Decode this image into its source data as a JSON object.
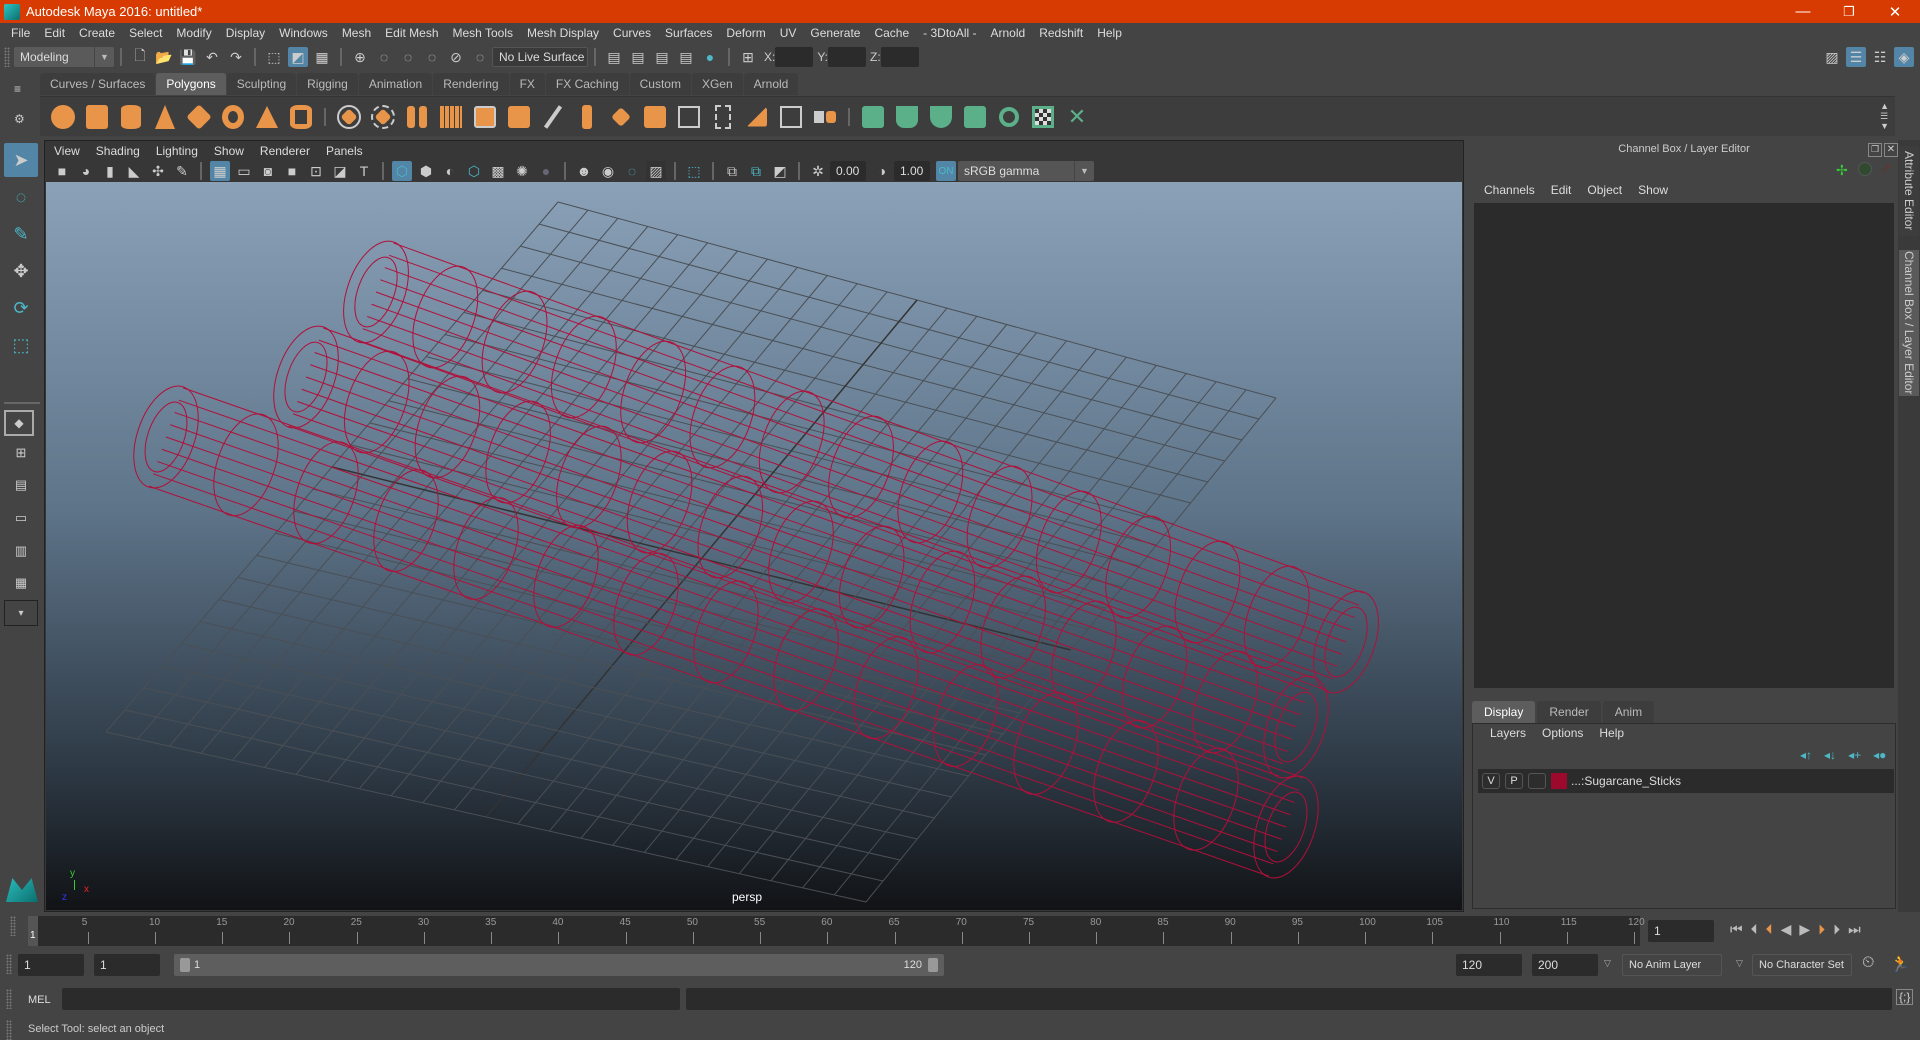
{
  "window": {
    "title": "Autodesk Maya 2016: untitled*",
    "controls": {
      "minimize": "—",
      "restore": "❐",
      "close": "✕"
    }
  },
  "menubar": [
    "File",
    "Edit",
    "Create",
    "Select",
    "Modify",
    "Display",
    "Windows",
    "Mesh",
    "Edit Mesh",
    "Mesh Tools",
    "Mesh Display",
    "Curves",
    "Surfaces",
    "Deform",
    "UV",
    "Generate",
    "Cache",
    "- 3DtoAll -",
    "Arnold",
    "Redshift",
    "Help"
  ],
  "statusline": {
    "menuset": "Modeling",
    "live_surface": "No Live Surface",
    "x_label": "X:",
    "y_label": "Y:",
    "z_label": "Z:",
    "x_value": "",
    "y_value": "",
    "z_value": ""
  },
  "shelf": {
    "tabs": [
      "Curves / Surfaces",
      "Polygons",
      "Sculpting",
      "Rigging",
      "Animation",
      "Rendering",
      "FX",
      "FX Caching",
      "Custom",
      "XGen",
      "Arnold"
    ],
    "active_tab": "Polygons",
    "icons": [
      "poly-sphere",
      "poly-cube",
      "poly-cylinder",
      "poly-cone",
      "poly-plane",
      "poly-torus",
      "poly-pyramid",
      "poly-pipe",
      "combine",
      "separate",
      "mirror",
      "smooth",
      "extract",
      "boolean",
      "bevel",
      "bridge",
      "extrude",
      "append",
      "multi-cut",
      "target-weld",
      "connect",
      "offset-edge-loop",
      "uv-planar",
      "uv-cylindrical",
      "uv-spherical",
      "uv-automatic",
      "uv-contour",
      "uv-editor",
      "uv-unfold"
    ]
  },
  "viewport": {
    "menu": [
      "View",
      "Shading",
      "Lighting",
      "Show",
      "Renderer",
      "Panels"
    ],
    "exposure": "0.00",
    "gamma": "1.00",
    "color_space": "sRGB gamma",
    "camera_label": "persp",
    "axis": {
      "x": "x",
      "y": "y",
      "z": "z"
    },
    "wire_color": "#b0103a"
  },
  "channel_box": {
    "title": "Channel Box / Layer Editor",
    "menu": [
      "Channels",
      "Edit",
      "Object",
      "Show"
    ]
  },
  "layer_editor": {
    "tabs": [
      "Display",
      "Render",
      "Anim"
    ],
    "active_tab": "Display",
    "menu": [
      "Layers",
      "Options",
      "Help"
    ],
    "layers": [
      {
        "v": "V",
        "p": "P",
        "color": "#9b0a2d",
        "name": "...:Sugarcane_Sticks"
      }
    ]
  },
  "side_tabs": [
    "Attribute Editor",
    "Channel Box / Layer Editor"
  ],
  "timeline": {
    "ticks": [
      5,
      10,
      15,
      20,
      25,
      30,
      35,
      40,
      45,
      50,
      55,
      60,
      65,
      70,
      75,
      80,
      85,
      90,
      95,
      100,
      105,
      110,
      115,
      120
    ],
    "current_frame": "1",
    "current_frame_field": "1"
  },
  "range": {
    "start": "1",
    "playback_start": "1",
    "slider_start": "1",
    "slider_end": "120",
    "playback_end": "120",
    "end": "200",
    "anim_layer": "No Anim Layer",
    "character_set": "No Character Set"
  },
  "command": {
    "label": "MEL",
    "input": ""
  },
  "help_line": "Select Tool: select an object"
}
